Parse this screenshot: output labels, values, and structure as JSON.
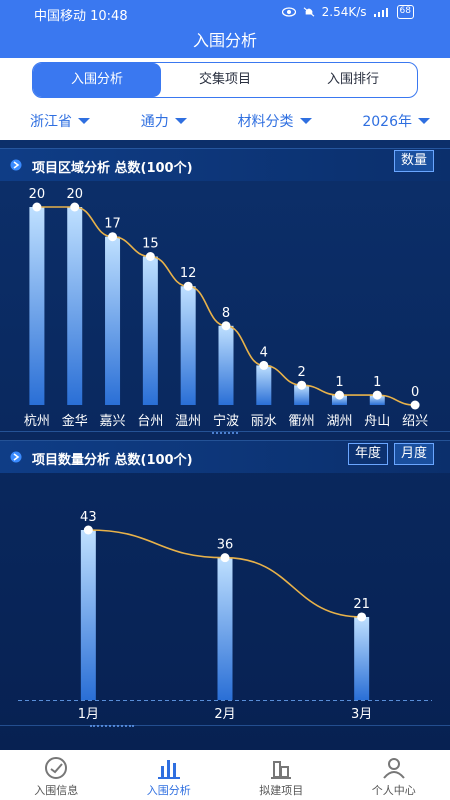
{
  "status": {
    "carrier_time": "中国移动 10:48",
    "speed": "2.54K/s",
    "battery": "68"
  },
  "header": {
    "title": "入围分析"
  },
  "tabs": [
    {
      "label": "入围分析",
      "active": true
    },
    {
      "label": "交集项目",
      "active": false
    },
    {
      "label": "入围排行",
      "active": false
    }
  ],
  "filters": [
    {
      "label": "浙江省"
    },
    {
      "label": "通力"
    },
    {
      "label": "材料分类"
    },
    {
      "label": "2026年"
    }
  ],
  "region_card": {
    "title": "项目区域分析 总数(100个)",
    "button": "数量"
  },
  "count_card": {
    "title": "项目数量分析 总数(100个)",
    "button_year": "年度",
    "button_month": "月度"
  },
  "nav": [
    {
      "label": "入围信息",
      "icon": "seal-icon",
      "active": false
    },
    {
      "label": "入围分析",
      "icon": "bar-chart-icon",
      "active": true
    },
    {
      "label": "拟建项目",
      "icon": "building-icon",
      "active": false
    },
    {
      "label": "个人中心",
      "icon": "person-icon",
      "active": false
    }
  ],
  "colors": {
    "accent": "#3a78f0",
    "line": "#e8b24a",
    "bar_top": "#bfe0ff",
    "bar_bottom": "#2a6fd6"
  },
  "chart_data": [
    {
      "type": "bar",
      "categories": [
        "杭州",
        "金华",
        "嘉兴",
        "台州",
        "温州",
        "宁波",
        "丽水",
        "衢州",
        "湖州",
        "舟山",
        "绍兴"
      ],
      "values": [
        20,
        20,
        17,
        15,
        12,
        8,
        4,
        2,
        1,
        1,
        0
      ],
      "ylim": [
        0,
        20
      ]
    },
    {
      "type": "bar",
      "categories": [
        "1月",
        "2月",
        "3月"
      ],
      "values": [
        43,
        36,
        21
      ],
      "ylim": [
        0,
        43
      ]
    }
  ]
}
